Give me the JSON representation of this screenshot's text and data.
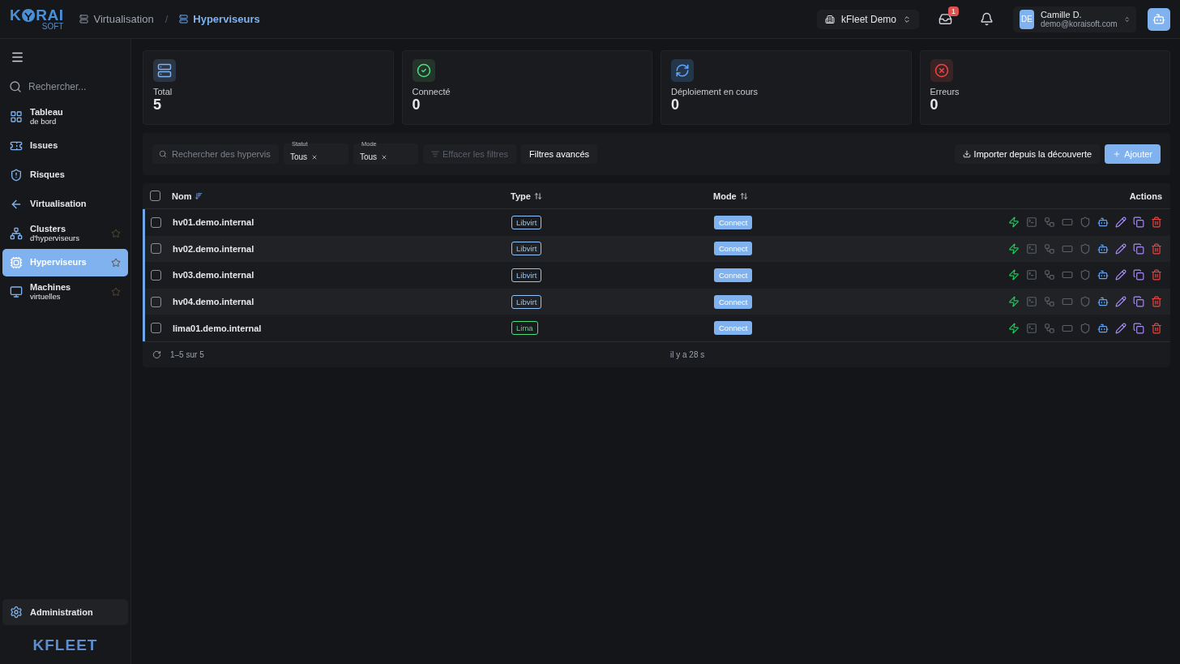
{
  "logo": {
    "first": "K",
    "rest": "RAI",
    "sub": "SOFT"
  },
  "breadcrumb_separator": "/",
  "breadcrumb": [
    {
      "label": "Virtualisation",
      "current": false
    },
    {
      "label": "Hyperviseurs",
      "current": true
    }
  ],
  "tenant": {
    "label": "kFleet Demo"
  },
  "inbox": {
    "badge": "1"
  },
  "user": {
    "initials": "DE",
    "name": "Camille D.",
    "email": "demo@koraisoft.com"
  },
  "sidebar": {
    "search_placeholder": "Rechercher...",
    "items": [
      {
        "label": "Tableau",
        "sub": "de bord",
        "selected": false
      },
      {
        "label": "Issues",
        "selected": false
      },
      {
        "label": "Risques",
        "selected": false
      },
      {
        "label": "Virtualisation",
        "selected": false
      },
      {
        "label": "Clusters",
        "sub": "d'hyperviseurs",
        "selected": false,
        "favorite": false
      },
      {
        "label": "Hyperviseurs",
        "selected": true,
        "favorite": false
      },
      {
        "label": "Machines",
        "sub": "virtuelles",
        "selected": false,
        "favorite": false
      }
    ],
    "admin": {
      "label": "Administration"
    },
    "brand": "KFLEET"
  },
  "stats": [
    {
      "kind": "total",
      "label": "Total",
      "value": "5"
    },
    {
      "kind": "connected",
      "label": "Connecté",
      "value": "0"
    },
    {
      "kind": "deploying",
      "label": "Déploiement en cours",
      "value": "0"
    },
    {
      "kind": "errors",
      "label": "Erreurs",
      "value": "0"
    }
  ],
  "filters": {
    "search_placeholder": "Rechercher des hypervis",
    "selects": [
      {
        "label": "Statut",
        "value": "Tous"
      },
      {
        "label": "Mode",
        "value": "Tous"
      }
    ],
    "clear": {
      "label": "Effacer les filtres",
      "disabled": true
    },
    "advanced": "Filtres avancés",
    "import": "Importer depuis la découverte",
    "add": "Ajouter"
  },
  "table": {
    "all_checked": false,
    "columns": [
      "Nom",
      "Type",
      "Mode",
      "Actions"
    ],
    "row_actions": [
      {
        "kind": "power",
        "disabled": false
      },
      {
        "kind": "terminal",
        "disabled": true
      },
      {
        "kind": "network",
        "disabled": true
      },
      {
        "kind": "console",
        "disabled": true
      },
      {
        "kind": "shield",
        "disabled": true
      },
      {
        "kind": "agent",
        "disabled": false
      },
      {
        "kind": "edit",
        "disabled": false
      },
      {
        "kind": "copy",
        "disabled": false
      },
      {
        "kind": "delete",
        "disabled": false
      }
    ],
    "rows": [
      {
        "name": "hv01.demo.internal",
        "type": "Libvirt",
        "color": "#93c5fd",
        "mode": "Connect",
        "checked": false
      },
      {
        "name": "hv02.demo.internal",
        "type": "Libvirt",
        "color": "#93c5fd",
        "mode": "Connect",
        "checked": false
      },
      {
        "name": "hv03.demo.internal",
        "type": "Libvirt",
        "color": "#93c5fd",
        "mode": "Connect",
        "checked": false
      },
      {
        "name": "hv04.demo.internal",
        "type": "Libvirt",
        "color": "#93c5fd",
        "mode": "Connect",
        "checked": false
      },
      {
        "name": "lima01.demo.internal",
        "type": "Lima",
        "color": "#4ade80",
        "mode": "Connect",
        "checked": false
      }
    ],
    "footer": {
      "count": "1–5 sur 5",
      "updated": "il y a 28 s"
    }
  }
}
